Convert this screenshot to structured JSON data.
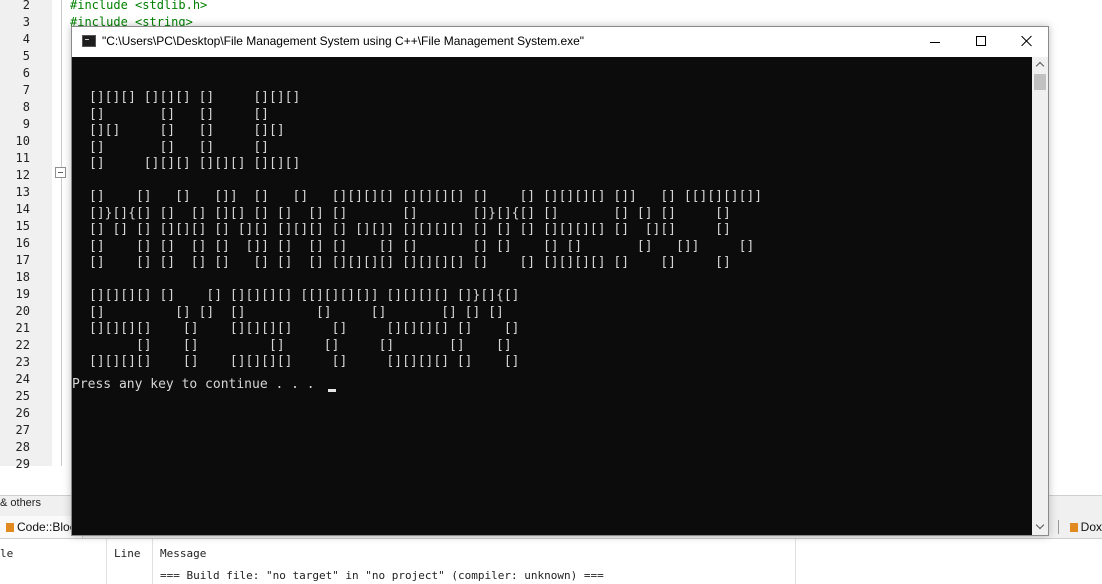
{
  "editor": {
    "line_numbers": [
      "2",
      "3",
      "4",
      "5",
      "6",
      "7",
      "8",
      "9",
      "10",
      "11",
      "12",
      "13",
      "14",
      "15",
      "16",
      "17",
      "18",
      "19",
      "20",
      "21",
      "22",
      "23",
      "24",
      "25",
      "26",
      "27",
      "28",
      "29"
    ],
    "code_lines": [
      "#include <stdlib.h>",
      "#include <string>"
    ]
  },
  "bottom_tabs": {
    "others_label": "& others",
    "codeblocks_label": "Code::Bloc",
    "dox_label": "Dox"
  },
  "log": {
    "col_file": "le",
    "col_line": "Line",
    "col_message": "Message",
    "message": "=== Build file: \"no target\" in \"no project\" (compiler: unknown) ==="
  },
  "console_window": {
    "title": "\"C:\\Users\\PC\\Desktop\\File Management System using C++\\File Management System.exe\"",
    "ascii_art": "[][][] [][][] []     [][][]\n[]       []   []     []\n[][]     []   []     [][]\n[]       []   []     []\n[]     [][][] [][][] [][][]\n\n[]    []   []   []]  []   []   [][][][] [][][][] []    [] [][][][] []]   [] [[][][][]]\n[]}[]{[] []  [] [][] [] []  [] []       []       []}[]{[] []       [] [] []     []\n[] [] [] [][][] [] [][] [][][] [] [][]] [][][][] [] [] [] [][][][] []  [][]     []\n[]    [] []  [] []  []] []  [] []    [] []       [] []    [] []       []   []]     []\n[]    [] []  [] []   [] []  [] [][][][] [][][][] []    [] [][][][] []    []     []\n\n[][][][] []    [] [][][][] [[][][][]] [][][][] []}[]{[]\n[]         [] []  []         []     []       [] [] []\n[][][][]    []    [][][][]     []     [][][][] []    []\n      []    []         []     []     []       []    []\n[][][][]    []    [][][][]     []     [][][][] []    []",
    "prompt": "Press any key to continue . . ."
  }
}
